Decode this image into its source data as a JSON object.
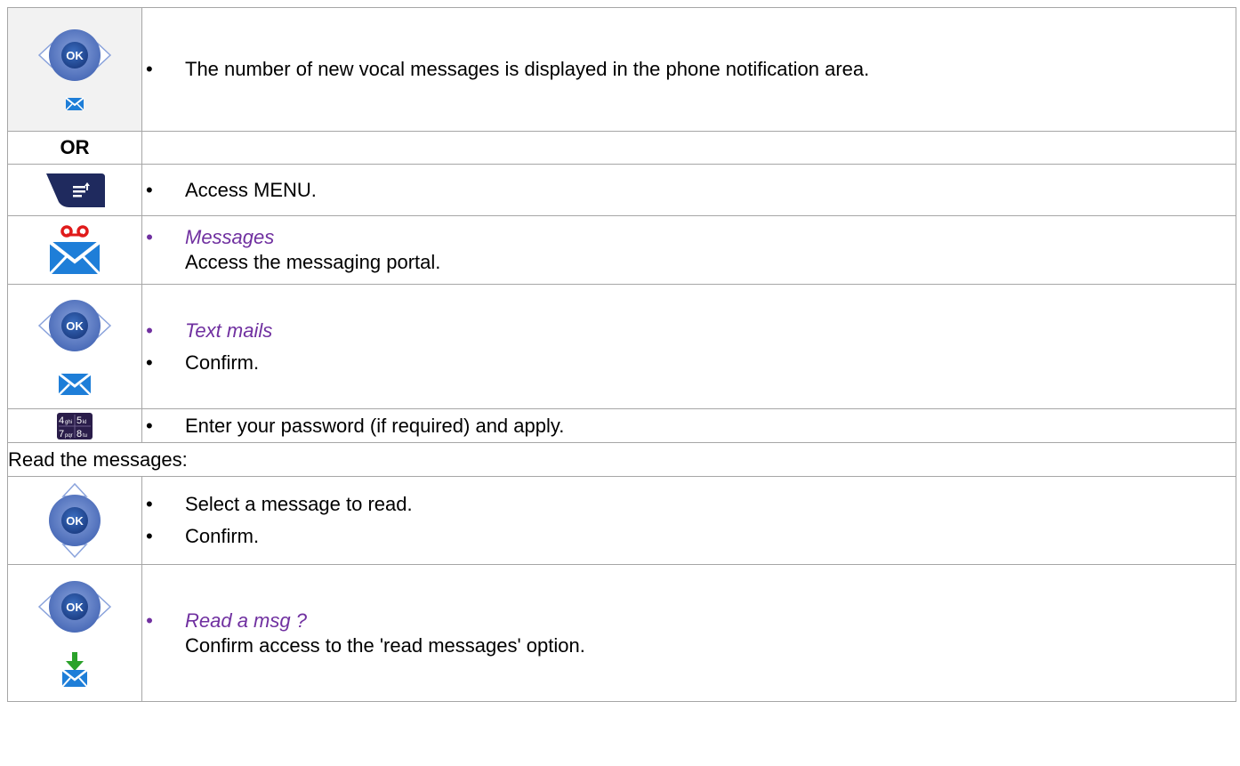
{
  "rows": {
    "r1": {
      "bullet": "The number of new vocal messages is displayed in the phone notification area."
    },
    "or_label": "OR",
    "r2": {
      "bullet": "Access MENU."
    },
    "r3": {
      "option": "Messages",
      "detail": "Access the messaging portal."
    },
    "r4": {
      "option": "Text mails",
      "bullet": "Confirm."
    },
    "r5": {
      "bullet": "Enter your password (if required) and apply."
    },
    "section": "Read the messages:",
    "r6": {
      "bullet1": "Select a message to read.",
      "bullet2": "Confirm."
    },
    "r7": {
      "option": "Read a msg ?",
      "detail": "Confirm access to the 'read messages' option."
    }
  },
  "icons": {
    "ok_label": "OK",
    "keypad": [
      "4",
      "ghi",
      "5",
      "kl",
      "7",
      "pqr",
      "8",
      "tu"
    ]
  },
  "colors": {
    "navy": "#1f2a5e",
    "ok_blue": "#2a5aa8",
    "ring": "#5b7cc4",
    "mail_blue": "#1e7ed8",
    "voicemail_red": "#e01b1b",
    "download_green": "#2aa12a",
    "option_purple": "#7030a0"
  }
}
